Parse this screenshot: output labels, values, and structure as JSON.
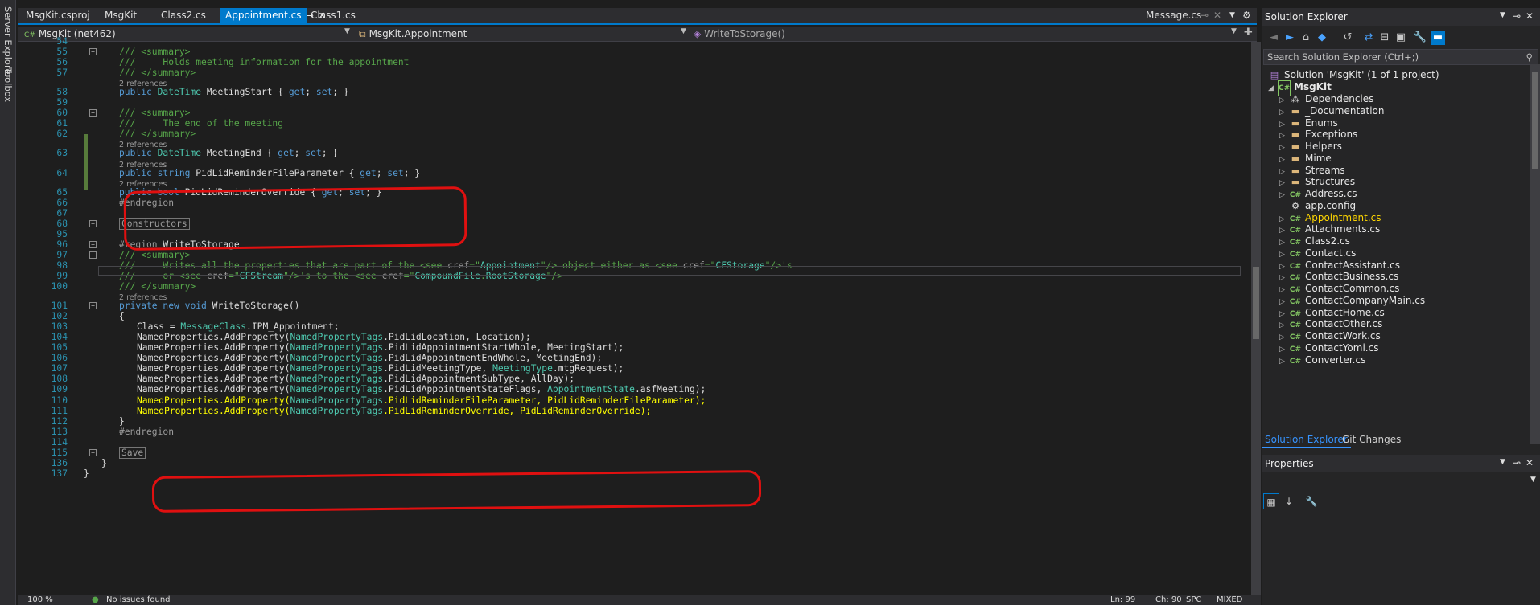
{
  "left_strip": {
    "server_explorer": "Server Explorer",
    "toolbox": "Toolbox"
  },
  "tabs": [
    {
      "label": "MsgKit.csproj",
      "active": false
    },
    {
      "label": "MsgKit",
      "active": false
    },
    {
      "label": "Class2.cs",
      "active": false
    },
    {
      "label": "Appointment.cs",
      "active": true
    },
    {
      "label": "Class1.cs",
      "active": false
    }
  ],
  "right_tab": "Message.cs",
  "navbar": {
    "project": "MsgKit (net462)",
    "class": "MsgKit.Appointment",
    "member": "WriteToStorage()"
  },
  "code_lines": [
    {
      "n": "54"
    },
    {
      "n": "55",
      "ind": 0,
      "html": "<span class='c'>/// &lt;summary&gt;</span>"
    },
    {
      "n": "56",
      "ind": 0,
      "html": "<span class='c'>///     Holds meeting information for the appointment</span>"
    },
    {
      "n": "57",
      "ind": 0,
      "html": "<span class='c'>/// &lt;/summary&gt;</span>"
    },
    {
      "refs": "2 references"
    },
    {
      "n": "58",
      "ind": 0,
      "html": "<span class='k'>public</span> <span class='t'>DateTime</span> MeetingStart { <span class='k'>get</span>; <span class='k'>set</span>; }"
    },
    {
      "n": "59"
    },
    {
      "n": "60",
      "ind": 0,
      "html": "<span class='c'>/// &lt;summary&gt;</span>"
    },
    {
      "n": "61",
      "ind": 0,
      "html": "<span class='c'>///     The end of the meeting</span>"
    },
    {
      "n": "62",
      "ind": 0,
      "html": "<span class='c'>/// &lt;/summary&gt;</span>"
    },
    {
      "refs": "2 references"
    },
    {
      "n": "63",
      "ind": 0,
      "html": "<span class='k'>public</span> <span class='t'>DateTime</span> MeetingEnd { <span class='k'>get</span>; <span class='k'>set</span>; }"
    },
    {
      "refs": "2 references"
    },
    {
      "n": "64",
      "ind": 0,
      "html": "<span class='k'>public</span> <span class='k'>string</span> PidLidReminderFileParameter { <span class='k'>get</span>; <span class='k'>set</span>; }"
    },
    {
      "refs": "2 references"
    },
    {
      "n": "65",
      "ind": 0,
      "html": "<span class='k'>public</span> <span class='k'>bool</span> PidLidReminderOverride { <span class='k'>get</span>; <span class='k'>set</span>; }"
    },
    {
      "n": "66",
      "ind": 0,
      "html": "<span class='d'>#endregion</span>"
    },
    {
      "n": "67"
    },
    {
      "n": "68",
      "ind": 0,
      "html": "<span class='coll'>Constructors</span>"
    },
    {
      "n": "95"
    },
    {
      "n": "96",
      "ind": 0,
      "html": "<span class='d'>#region</span> WriteToStorage"
    },
    {
      "n": "97",
      "ind": 0,
      "html": "<span class='c'>/// &lt;summary&gt;</span>"
    },
    {
      "n": "98",
      "ind": 0,
      "html": "<span class='c'>///     Writes all the properties that are part of the &lt;see </span><span class='p'>cref</span><span class='c'>=\"</span><span class='t'>Appointment</span><span class='c'>\"/&gt; object either as &lt;see </span><span class='p'>cref</span><span class='c'>=\"</span><span class='t'>CFStorage</span><span class='c'>\"/&gt;'s</span>"
    },
    {
      "n": "99",
      "ind": 0,
      "html": "<span class='c'>///     or &lt;see </span><span class='p'>cref</span><span class='c'>=\"</span><span class='t'>CFStream</span><span class='c'>\"/&gt;'s to the &lt;see </span><span class='p'>cref</span><span class='c'>=\"</span><span class='t'>CompoundFile</span><span class='c'>.</span><span class='t'>RootStorage</span><span class='c'>\"/&gt;</span>"
    },
    {
      "n": "100",
      "ind": 0,
      "html": "<span class='c'>/// &lt;/summary&gt;</span>"
    },
    {
      "refs": "2 references"
    },
    {
      "n": "101",
      "ind": 0,
      "html": "<span class='k'>private</span> <span class='k'>new</span> <span class='k'>void</span> WriteToStorage()"
    },
    {
      "n": "102",
      "ind": 0,
      "html": "{"
    },
    {
      "n": "103",
      "ind": 1,
      "html": "Class = <span class='t'>MessageClass</span>.IPM_Appointment;"
    },
    {
      "n": "104",
      "ind": 1,
      "html": "NamedProperties.AddProperty(<span class='t'>NamedPropertyTags</span>.PidLidLocation, Location);"
    },
    {
      "n": "105",
      "ind": 1,
      "html": "NamedProperties.AddProperty(<span class='t'>NamedPropertyTags</span>.PidLidAppointmentStartWhole, MeetingStart);"
    },
    {
      "n": "106",
      "ind": 1,
      "html": "NamedProperties.AddProperty(<span class='t'>NamedPropertyTags</span>.PidLidAppointmentEndWhole, MeetingEnd);"
    },
    {
      "n": "107",
      "ind": 1,
      "html": "NamedProperties.AddProperty(<span class='t'>NamedPropertyTags</span>.PidLidMeetingType, <span class='t'>MeetingType</span>.mtgRequest);"
    },
    {
      "n": "108",
      "ind": 1,
      "html": "NamedProperties.AddProperty(<span class='t'>NamedPropertyTags</span>.PidLidAppointmentSubType, AllDay);"
    },
    {
      "n": "109",
      "ind": 1,
      "html": "NamedProperties.AddProperty(<span class='t'>NamedPropertyTags</span>.PidLidAppointmentStateFlags, <span class='t'>AppointmentState</span>.asfMeeting);"
    },
    {
      "n": "110",
      "ind": 1,
      "html": "<span class='yel'>NamedProperties.AddProperty(</span><span class='t'>NamedPropertyTags</span><span class='yel'>.PidLidReminderFileParameter, PidLidReminderFileParameter);</span>"
    },
    {
      "n": "111",
      "ind": 1,
      "html": "<span class='yel'>NamedProperties.AddProperty(</span><span class='t'>NamedPropertyTags</span><span class='yel'>.PidLidReminderOverride, PidLidReminderOverride);</span>"
    },
    {
      "n": "112",
      "ind": 0,
      "html": "}"
    },
    {
      "n": "113",
      "ind": 0,
      "html": "<span class='d'>#endregion</span>"
    },
    {
      "n": "114"
    },
    {
      "n": "115",
      "ind": 0,
      "html": "<span class='coll'>Save</span>"
    },
    {
      "n": "136",
      "ind": -1,
      "html": "}"
    },
    {
      "n": "137",
      "ind": -2,
      "html": "}"
    }
  ],
  "status": {
    "zoom": "100 %",
    "issues": "No issues found",
    "ln": "Ln: 99",
    "ch": "Ch: 90",
    "spc": "SPC",
    "eol": "MIXED"
  },
  "solution_explorer": {
    "title": "Solution Explorer",
    "search_placeholder": "Search Solution Explorer (Ctrl+;)",
    "solution": "Solution 'MsgKit' (1 of 1 project)",
    "project": "MsgKit",
    "items": [
      {
        "label": "Dependencies",
        "kind": "deps"
      },
      {
        "label": "_Documentation",
        "kind": "folder"
      },
      {
        "label": "Enums",
        "kind": "folder"
      },
      {
        "label": "Exceptions",
        "kind": "folder"
      },
      {
        "label": "Helpers",
        "kind": "folder"
      },
      {
        "label": "Mime",
        "kind": "folder"
      },
      {
        "label": "Streams",
        "kind": "folder"
      },
      {
        "label": "Structures",
        "kind": "folder"
      },
      {
        "label": "Address.cs",
        "kind": "cs"
      },
      {
        "label": "app.config",
        "kind": "config"
      },
      {
        "label": "Appointment.cs",
        "kind": "cs"
      },
      {
        "label": "Attachments.cs",
        "kind": "cs"
      },
      {
        "label": "Class2.cs",
        "kind": "cs"
      },
      {
        "label": "Contact.cs",
        "kind": "cs"
      },
      {
        "label": "ContactAssistant.cs",
        "kind": "cs"
      },
      {
        "label": "ContactBusiness.cs",
        "kind": "cs"
      },
      {
        "label": "ContactCommon.cs",
        "kind": "cs"
      },
      {
        "label": "ContactCompanyMain.cs",
        "kind": "cs"
      },
      {
        "label": "ContactHome.cs",
        "kind": "cs"
      },
      {
        "label": "ContactOther.cs",
        "kind": "cs"
      },
      {
        "label": "ContactWork.cs",
        "kind": "cs"
      },
      {
        "label": "ContactYomi.cs",
        "kind": "cs"
      },
      {
        "label": "Converter.cs",
        "kind": "cs"
      }
    ],
    "bottom_tabs": [
      "Solution Explorer",
      "Git Changes"
    ]
  },
  "properties": {
    "title": "Properties"
  },
  "colors": {
    "accent": "#007acc",
    "annotation": "#e01010",
    "highlight_text": "#ffff00",
    "comment": "#57a64a",
    "keyword": "#569cd6",
    "type": "#4ec9b0"
  }
}
